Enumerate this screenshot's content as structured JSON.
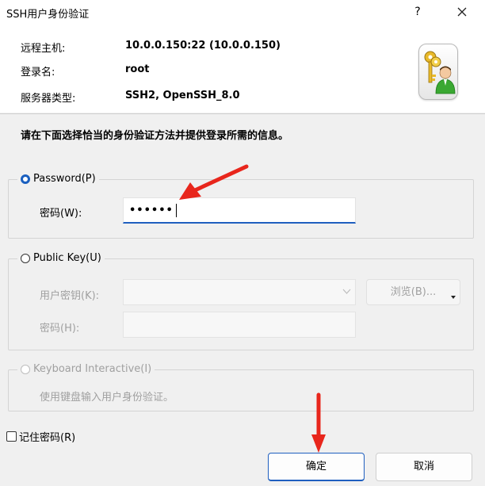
{
  "window": {
    "title": "SSH用户身份验证",
    "help": "?",
    "close": "close"
  },
  "header": {
    "remote_host_label": "远程主机:",
    "remote_host_value": "10.0.0.150:22 (10.0.0.150)",
    "login_label": "登录名:",
    "login_value": "root",
    "server_type_label": "服务器类型:",
    "server_type_value": "SSH2, OpenSSH_8.0",
    "icon": "keys-user-icon"
  },
  "instruction": "请在下面选择恰当的身份验证方法并提供登录所需的信息。",
  "password_group": {
    "label": "Password(P)",
    "field_label": "密码(W):",
    "value": "••••••"
  },
  "publickey_group": {
    "label": "Public Key(U)",
    "key_label": "用户密钥(K):",
    "passphrase_label": "密码(H):",
    "browse_label": "浏览(B)..."
  },
  "keyboard_group": {
    "label": "Keyboard Interactive(I)",
    "description": "使用键盘输入用户身份验证。"
  },
  "remember": "记住密码(R)",
  "buttons": {
    "ok": "确定",
    "cancel": "取消"
  },
  "colors": {
    "accent": "#1f5fbf",
    "annotation_arrow": "#e8261c"
  }
}
